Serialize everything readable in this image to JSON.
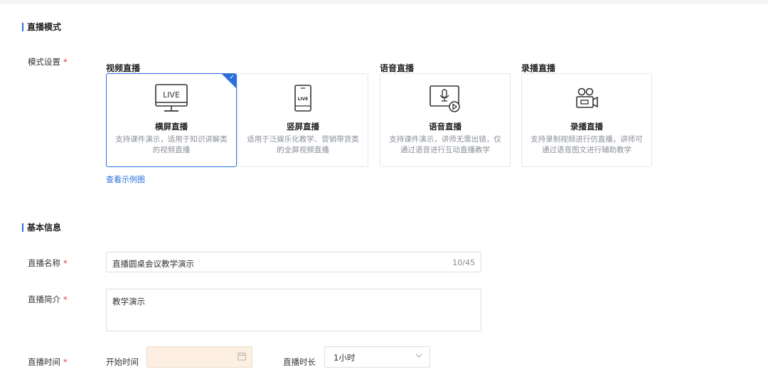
{
  "sections": {
    "live_mode": "直播模式",
    "basic_info": "基本信息"
  },
  "mode": {
    "label": "模式设置",
    "required": "*",
    "groups": {
      "video": "视频直播",
      "audio": "语音直播",
      "record": "录播直播"
    },
    "cards": [
      {
        "title": "横屏直播",
        "desc": "支持课件演示，适用于知识讲解类的视频直播",
        "icon": "monitor-live-icon",
        "selected": true
      },
      {
        "title": "竖屏直播",
        "desc": "适用于泛娱乐化教学、营销带货类的全屏视频直播",
        "icon": "phone-live-icon",
        "selected": false
      },
      {
        "title": "语音直播",
        "desc": "支持课件演示，讲师无需出镜，仅通过语音进行互动直播教学",
        "icon": "microphone-screen-icon",
        "selected": false
      },
      {
        "title": "录播直播",
        "desc": "支持录制视频进行仿直播，讲师可通过语音图文进行辅助教学",
        "icon": "video-camera-icon",
        "selected": false
      }
    ],
    "example_link": "查看示例图"
  },
  "form": {
    "name": {
      "label": "直播名称",
      "required": "*",
      "value": "直播圆桌会议教学演示",
      "counter": "10/45"
    },
    "intro": {
      "label": "直播简介",
      "required": "*",
      "value": "教学演示"
    },
    "time": {
      "label": "直播时间",
      "required": "*",
      "start_label": "开始时间",
      "start_value": "",
      "duration_label": "直播时长",
      "duration_value": "1小时"
    }
  },
  "colors": {
    "accent": "#2a6fdb",
    "required": "#e4393c",
    "date_bg": "#fdf0e3"
  }
}
